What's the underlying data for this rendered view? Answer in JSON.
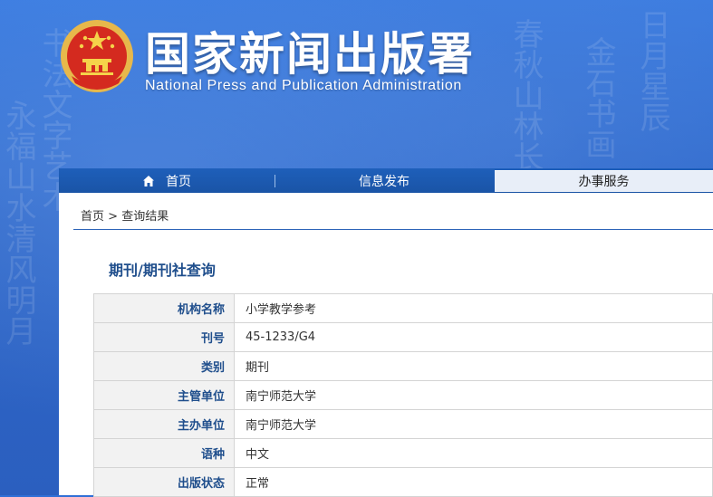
{
  "header": {
    "title": "国家新闻出版署",
    "subtitle": "National Press and Publication Administration"
  },
  "nav": {
    "home": "首页",
    "info": "信息发布",
    "service": "办事服务"
  },
  "breadcrumb": {
    "home": "首页",
    "separator": ">",
    "current": "查询结果"
  },
  "query": {
    "title": "期刊/期刊社查询"
  },
  "result": {
    "rows": [
      {
        "label": "机构名称",
        "value": "小学教学参考"
      },
      {
        "label": "刊号",
        "value": "45-1233/G4"
      },
      {
        "label": "类别",
        "value": "期刊"
      },
      {
        "label": "主管单位",
        "value": "南宁师范大学"
      },
      {
        "label": "主办单位",
        "value": "南宁师范大学"
      },
      {
        "label": "语种",
        "value": "中文"
      },
      {
        "label": "出版状态",
        "value": "正常"
      }
    ]
  },
  "colors": {
    "nav_bg": "#1e5fba",
    "label_text": "#1f4e8c",
    "label_bg": "#f2f2f2"
  }
}
